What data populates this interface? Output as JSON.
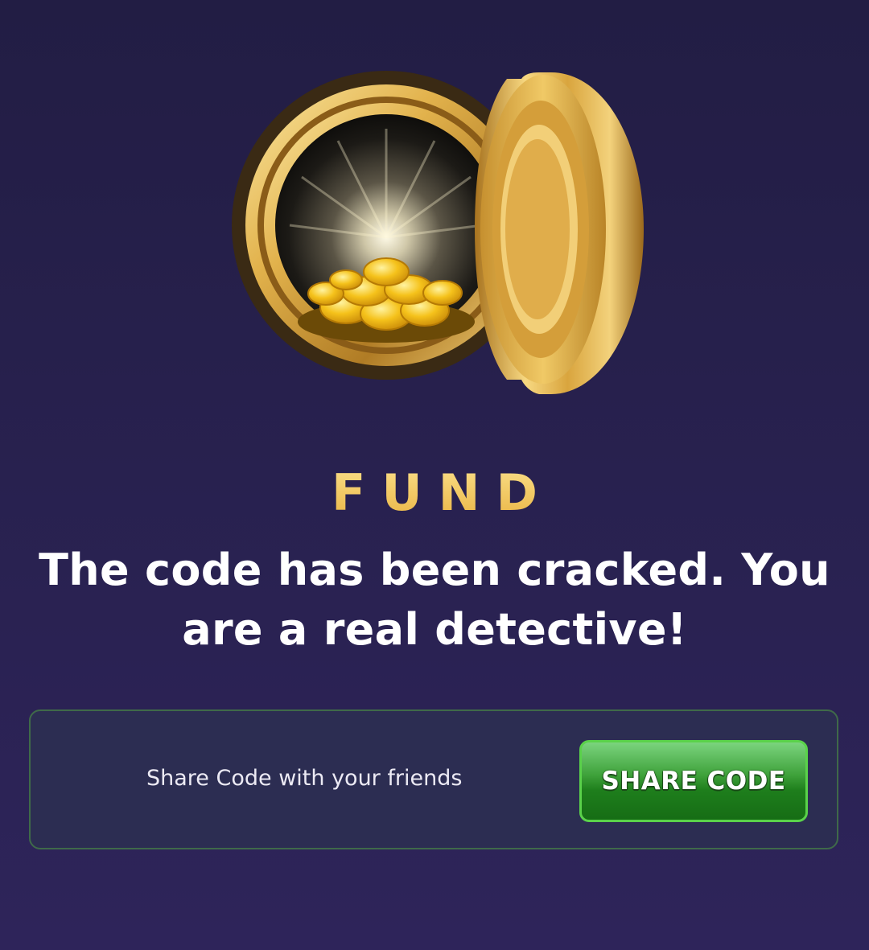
{
  "hero": {
    "image": "gold-vault-with-coins-icon"
  },
  "title": "FUND",
  "message": "The code has been cracked. You are a real detective!",
  "share_panel": {
    "text": "Share Code with your friends",
    "button_label": "SHARE CODE"
  },
  "colors": {
    "background": "#28214f",
    "title_gold": "#f2c85a",
    "panel_border": "#3f6a49",
    "button_green": "#2f9a2c"
  }
}
